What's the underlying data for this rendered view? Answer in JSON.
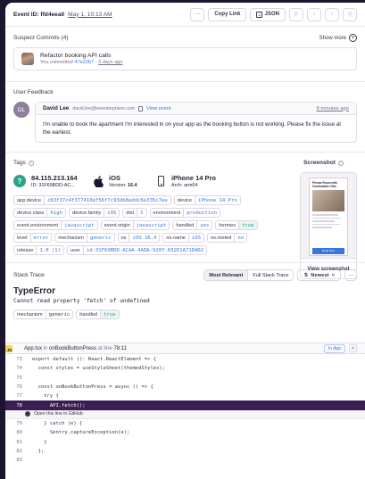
{
  "header": {
    "event_label": "Event ID: ffd4eea0",
    "date": "May 1, 10:13 AM",
    "more_label": "···",
    "copy_link_label": "Copy Link",
    "json_label": "JSON"
  },
  "suspect_commits": {
    "title": "Suspect Commits (4)",
    "show_more_label": "Show more",
    "commit_title": "Refactor booking API calls",
    "committed_prefix": "You committed",
    "commit_hash": "47e22b7",
    "commit_age": "3 days ago"
  },
  "feedback": {
    "title": "User Feedback",
    "avatar_initials": "DL",
    "name": "David Lee",
    "email": "david.lee@leeenterprises.com",
    "view_event_label": "View event",
    "time": "8 minutes ago",
    "message": "I'm unable to book the apartment I'm interested in on your app as the booking button is not working. Please fix the issue at the earliest."
  },
  "tags": {
    "title": "Tags",
    "screenshot_title": "Screenshot",
    "view_screenshot_label": "View screenshot",
    "summary": [
      {
        "primary": "84.115.213.164",
        "key": "ID:",
        "value": "31F69BDD-AC..."
      },
      {
        "primary": "iOS",
        "key": "Version:",
        "value": "16.4"
      },
      {
        "primary": "iPhone 14 Pro",
        "key": "Arch:",
        "value": "arm64"
      }
    ],
    "rows": [
      [
        {
          "k": "app.device",
          "v": "c63f37c4f377410ef56f7c93db8addc6e335c7ee"
        },
        {
          "k": "device",
          "v": "iPhone 14 Pro"
        }
      ],
      [
        {
          "k": "device.class",
          "v": "high"
        },
        {
          "k": "device.family",
          "v": "iOS"
        },
        {
          "k": "dist",
          "v": "1"
        },
        {
          "k": "environment",
          "v": "production"
        }
      ],
      [
        {
          "k": "event.environment",
          "v": "javascript"
        },
        {
          "k": "event.origin",
          "v": "javascript"
        },
        {
          "k": "handled",
          "v": "yes"
        },
        {
          "k": "hermes",
          "v": "true"
        }
      ],
      [
        {
          "k": "level",
          "v": "error"
        },
        {
          "k": "mechanism",
          "v": "generic"
        },
        {
          "k": "os",
          "v": "iOS 16.4"
        },
        {
          "k": "os.name",
          "v": "iOS"
        },
        {
          "k": "os.rooted",
          "v": "no"
        }
      ],
      [
        {
          "k": "release",
          "v": "1.0 (1)"
        },
        {
          "k": "user",
          "v": "id:31F69BDD-ACAA-4ADA-9207-832D1A71DAD2"
        }
      ]
    ],
    "preview": {
      "heading": "Private Room with Comfortable View",
      "button": "Book Now"
    }
  },
  "stack_trace": {
    "title": "Stack Trace",
    "most_relevant_label": "Most Relevant",
    "full_stack_label": "Full Stack Trace",
    "sort_label": "Newest",
    "error_type": "TypeError",
    "error_message": "Cannot read property 'fetch' of undefined",
    "mech_tags": [
      {
        "k": "mechanism",
        "v": "generic"
      },
      {
        "k": "handled",
        "v": "true"
      }
    ],
    "js_badge": "JS",
    "frame_file": "App.tsx",
    "frame_in": "in",
    "frame_fn": "onBookButtonPress",
    "frame_at": "at line",
    "frame_line": "78:11",
    "in_app_label": "In App",
    "open_github_label": "Open this line in GitHub",
    "code_before": [
      {
        "ln": "73",
        "code": "export default (): React.ReactElement => {"
      },
      {
        "ln": "74",
        "code": "  const styles = useStyleSheet(themedStyles);"
      },
      {
        "ln": "75",
        "code": ""
      },
      {
        "ln": "76",
        "code": "  const onBookButtonPress = async () => {"
      },
      {
        "ln": "77",
        "code": "    try {"
      }
    ],
    "code_highlight": {
      "ln": "78",
      "code": "      API.fetch();"
    },
    "code_after": [
      {
        "ln": "79",
        "code": "    } catch (e) {"
      },
      {
        "ln": "80",
        "code": "      Sentry.captureException(e);"
      },
      {
        "ln": "81",
        "code": "    }"
      },
      {
        "ln": "82",
        "code": "  };"
      },
      {
        "ln": "83",
        "code": ""
      }
    ]
  },
  "colors": {
    "outer_bg": "#1b1530",
    "highlight": "#3b1e54",
    "link": "#3c74dd",
    "green": "#2ba185"
  }
}
